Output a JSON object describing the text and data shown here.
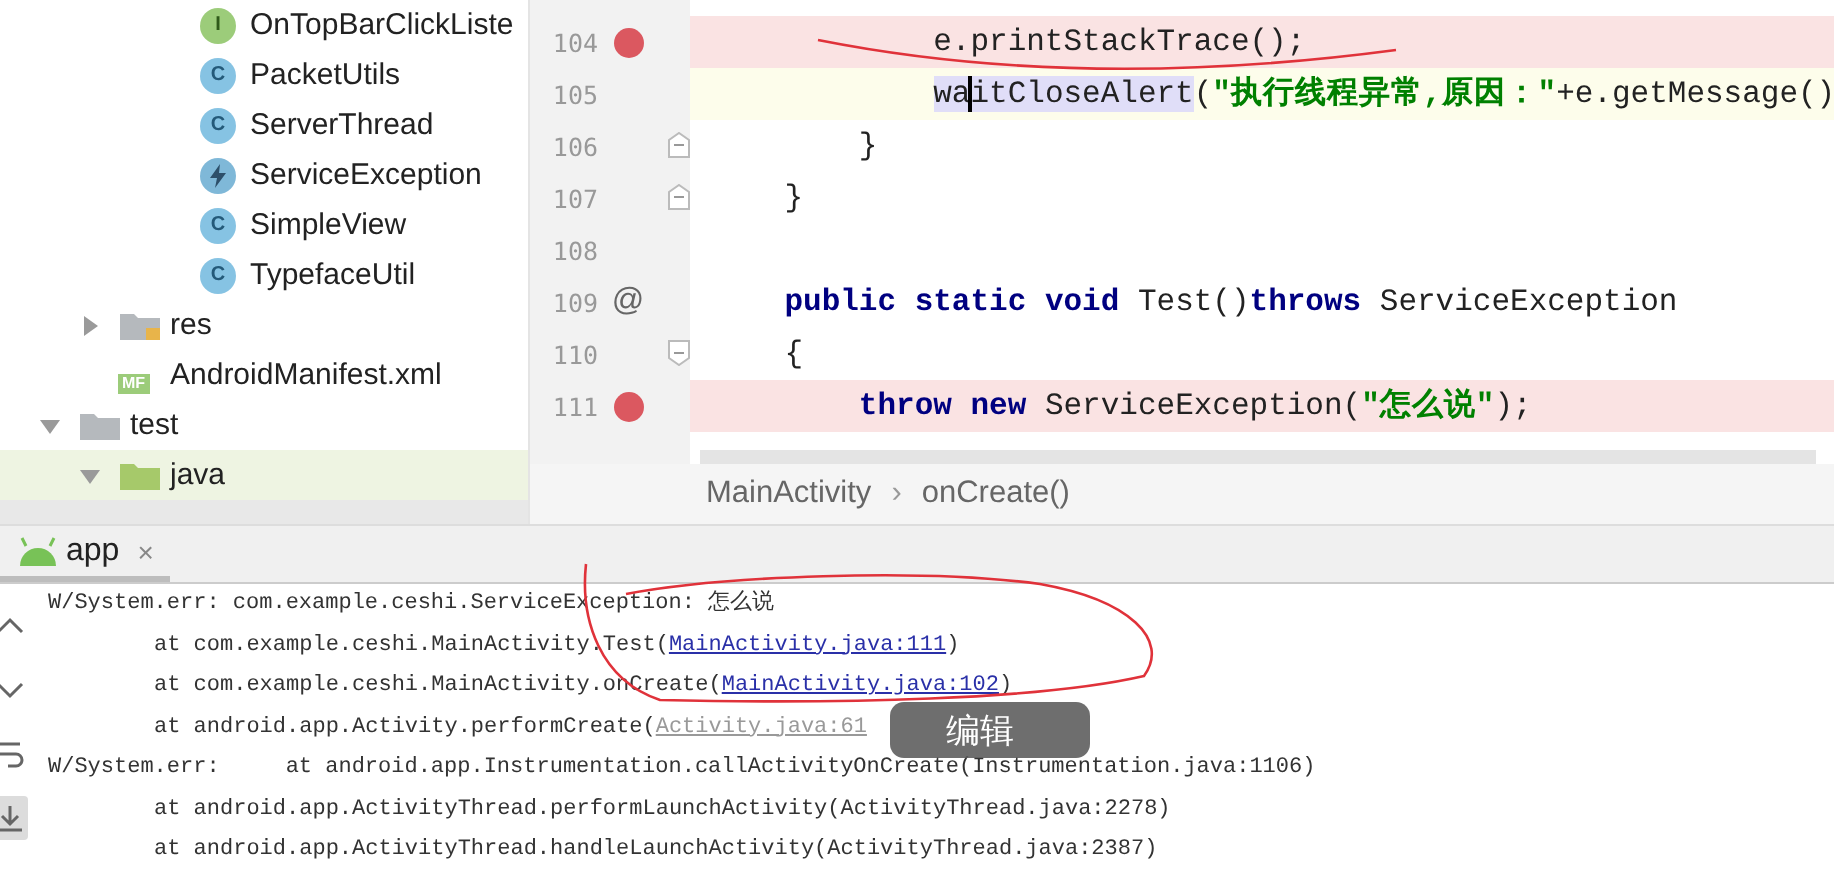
{
  "project_tree": {
    "classes": [
      {
        "badge": "I",
        "label": "OnTopBarClickListe",
        "kind": "interface",
        "selected": false
      },
      {
        "badge": "C",
        "label": "PacketUtils",
        "kind": "class",
        "selected": false
      },
      {
        "badge": "C",
        "label": "ServerThread",
        "kind": "class",
        "selected": false
      },
      {
        "label": "ServiceException",
        "kind": "exception",
        "selected": false
      },
      {
        "badge": "C",
        "label": "SimpleView",
        "kind": "class",
        "selected": false
      },
      {
        "badge": "C",
        "label": "TypefaceUtil",
        "kind": "class",
        "selected": false
      }
    ],
    "items": [
      {
        "label": "res",
        "kind": "resource_folder",
        "expanded": false,
        "selected": false
      },
      {
        "label": "AndroidManifest.xml",
        "kind": "manifest",
        "badge": "MF",
        "selected": false
      },
      {
        "label": "test",
        "kind": "folder",
        "expanded": true,
        "selected": false,
        "children": [
          {
            "label": "java",
            "kind": "source_folder",
            "expanded": true,
            "selected": true
          }
        ]
      }
    ]
  },
  "editor": {
    "lines": [
      {
        "number": "104",
        "breakpoint": true,
        "current": false,
        "tokens": [
          {
            "text": "            e.printStackTrace();",
            "kind": "plain"
          }
        ]
      },
      {
        "number": "105",
        "breakpoint": false,
        "current": true,
        "tokens": [
          {
            "text": "            wa",
            "kind": "highlight"
          },
          {
            "text": "itCloseAlert",
            "kind": "highlight",
            "caret": true
          },
          {
            "text": "(",
            "kind": "plain"
          },
          {
            "text": "\"执行线程异常,原因：\"",
            "kind": "string"
          },
          {
            "text": "+e.getMessage()",
            "kind": "plain"
          }
        ]
      },
      {
        "number": "106",
        "breakpoint": false,
        "current": false,
        "fold": {
          "kind": "end"
        },
        "tokens": [
          {
            "text": "        }",
            "kind": "plain"
          }
        ]
      },
      {
        "number": "107",
        "breakpoint": false,
        "current": false,
        "fold": {
          "kind": "end"
        },
        "tokens": [
          {
            "text": "    }",
            "kind": "plain"
          }
        ]
      },
      {
        "number": "108",
        "breakpoint": false,
        "current": false
      },
      {
        "number": "109",
        "breakpoint": false,
        "current": false,
        "gutter_icon": "@",
        "tokens": [
          {
            "text": "    public static void",
            "kind": "keyword"
          },
          {
            "text": " Test()",
            "kind": "plain"
          },
          {
            "text": "throws",
            "kind": "keyword"
          },
          {
            "text": " ServiceException",
            "kind": "plain"
          }
        ]
      },
      {
        "number": "110",
        "breakpoint": false,
        "current": false,
        "fold": {
          "kind": "start"
        },
        "tokens": [
          {
            "text": "    {",
            "kind": "plain"
          }
        ]
      },
      {
        "number": "111",
        "breakpoint": true,
        "current": false,
        "tokens": [
          {
            "text": "        throw new",
            "kind": "keyword"
          },
          {
            "text": " ServiceException(",
            "kind": "plain"
          },
          {
            "text": "\"怎么说\"",
            "kind": "string"
          },
          {
            "text": ");",
            "kind": "plain"
          }
        ]
      }
    ],
    "breadcrumb": {
      "items": [
        "MainActivity",
        "onCreate()"
      ],
      "separator": "›"
    }
  },
  "run_panel": {
    "tabs": [
      {
        "label": "app",
        "close": "×",
        "selected": true
      }
    ],
    "tool_buttons": [
      {
        "kind": "up",
        "on": false
      },
      {
        "kind": "down",
        "on": false
      },
      {
        "kind": "wrap",
        "on": false
      },
      {
        "kind": "scroll_end",
        "on": true
      }
    ],
    "log_lines": [
      {
        "kind": "header",
        "parts": [
          {
            "text": "W/System.err: com.example.ceshi.ServiceException: 怎么说",
            "kind": "plain"
          }
        ]
      },
      {
        "kind": "frame",
        "parts": [
          {
            "text": "at com.example.ceshi.MainActivity.Test(",
            "kind": "plain"
          },
          {
            "text": "MainActivity.java:111",
            "kind": "link"
          },
          {
            "text": ")",
            "kind": "plain"
          }
        ]
      },
      {
        "kind": "frame",
        "parts": [
          {
            "text": "at com.example.ceshi.MainActivity.onCreate(",
            "kind": "plain"
          },
          {
            "text": "MainActivity.java:102",
            "kind": "link"
          },
          {
            "text": ")",
            "kind": "plain"
          }
        ]
      },
      {
        "kind": "frame",
        "parts": [
          {
            "text": "at android.app.Activity.performCreate(",
            "kind": "plain"
          },
          {
            "text": "Activity.java:61",
            "kind": "muted_link"
          }
        ]
      },
      {
        "kind": "header",
        "parts": [
          {
            "text": "W/System.err:     at android.app.Instrumentation.callActivityOnCreate(Instrumentation.java:1106)",
            "kind": "plain"
          }
        ]
      },
      {
        "kind": "frame",
        "parts": [
          {
            "text": "at android.app.ActivityThread.performLaunchActivity(ActivityThread.java:2278)",
            "kind": "plain"
          }
        ]
      },
      {
        "kind": "frame",
        "parts": [
          {
            "text": "at android.app.ActivityThread.handleLaunchActivity(ActivityThread.java:2387)",
            "kind": "plain"
          }
        ]
      }
    ]
  },
  "edit_popup": {
    "label": "编辑"
  }
}
